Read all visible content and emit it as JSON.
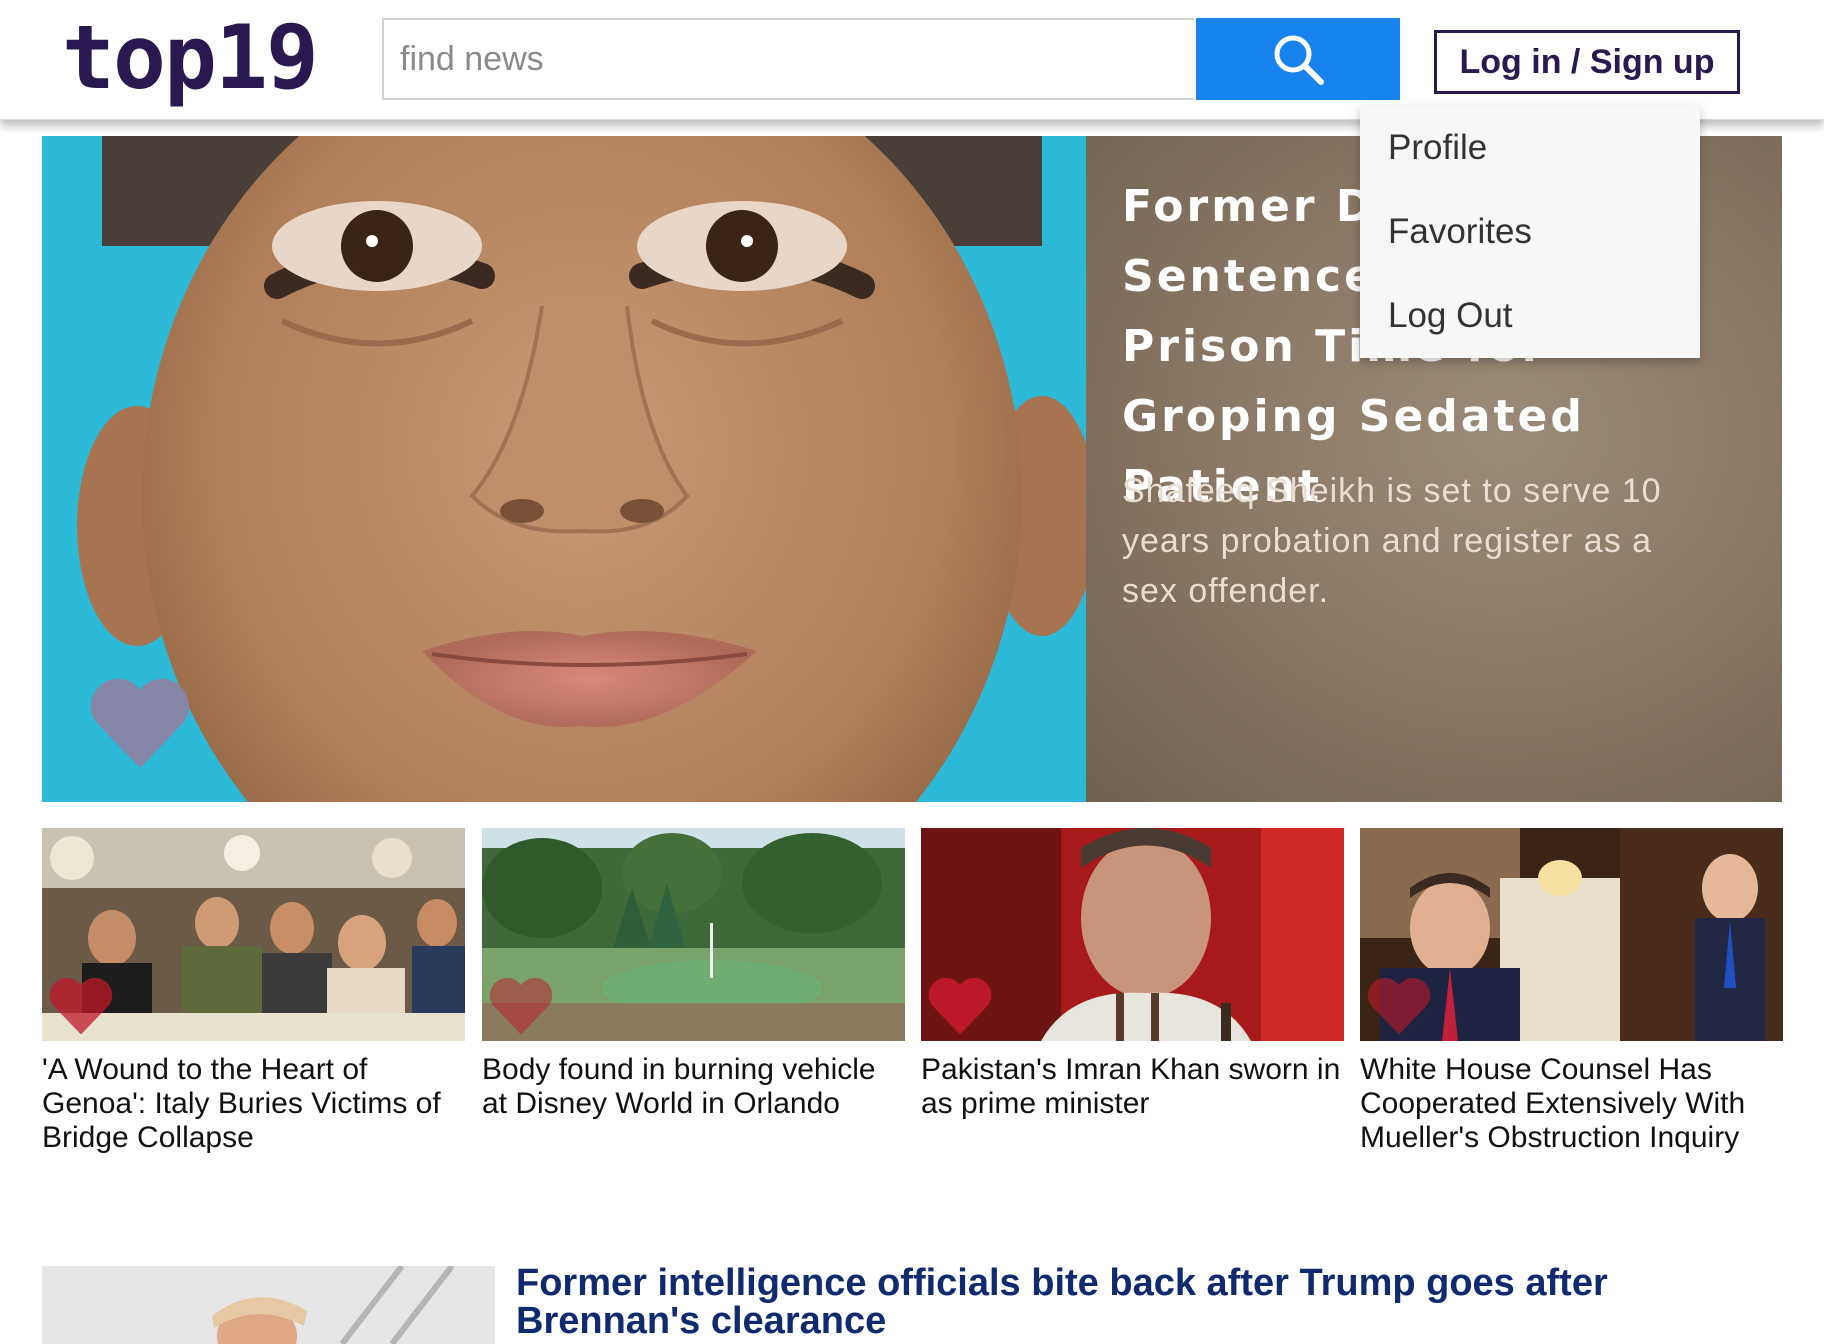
{
  "header": {
    "logo": "top19",
    "search_placeholder": "find news",
    "login_label": "Log in / Sign up"
  },
  "user_menu": {
    "items": [
      "Profile",
      "Favorites",
      "Log Out"
    ]
  },
  "hero": {
    "title": "Former Doctor Sentenced to No Prison Time for Groping Sedated Patient",
    "subtitle": "Shafeeq Sheikh is set to serve 10 years probation and register as a sex offender."
  },
  "cards": [
    {
      "title": "'A Wound to the Heart of Genoa': Italy Buries Victims of Bridge Collapse"
    },
    {
      "title": "Body found in burning vehicle at Disney World in Orlando"
    },
    {
      "title": "Pakistan's Imran Khan sworn in as prime minister"
    },
    {
      "title": "White House Counsel Has Cooperated Extensively With Mueller's Obstruction Inquiry"
    }
  ],
  "bottom_story": {
    "title": "Former intelligence officials bite back after Trump goes after Brennan's clearance"
  },
  "colors": {
    "brand": "#2a1850",
    "search_button": "#1783ef",
    "link": "#0f2a6e",
    "heart_red": "#c0182b"
  },
  "icons": {
    "search": "search-icon",
    "favorite": "heart-icon"
  }
}
